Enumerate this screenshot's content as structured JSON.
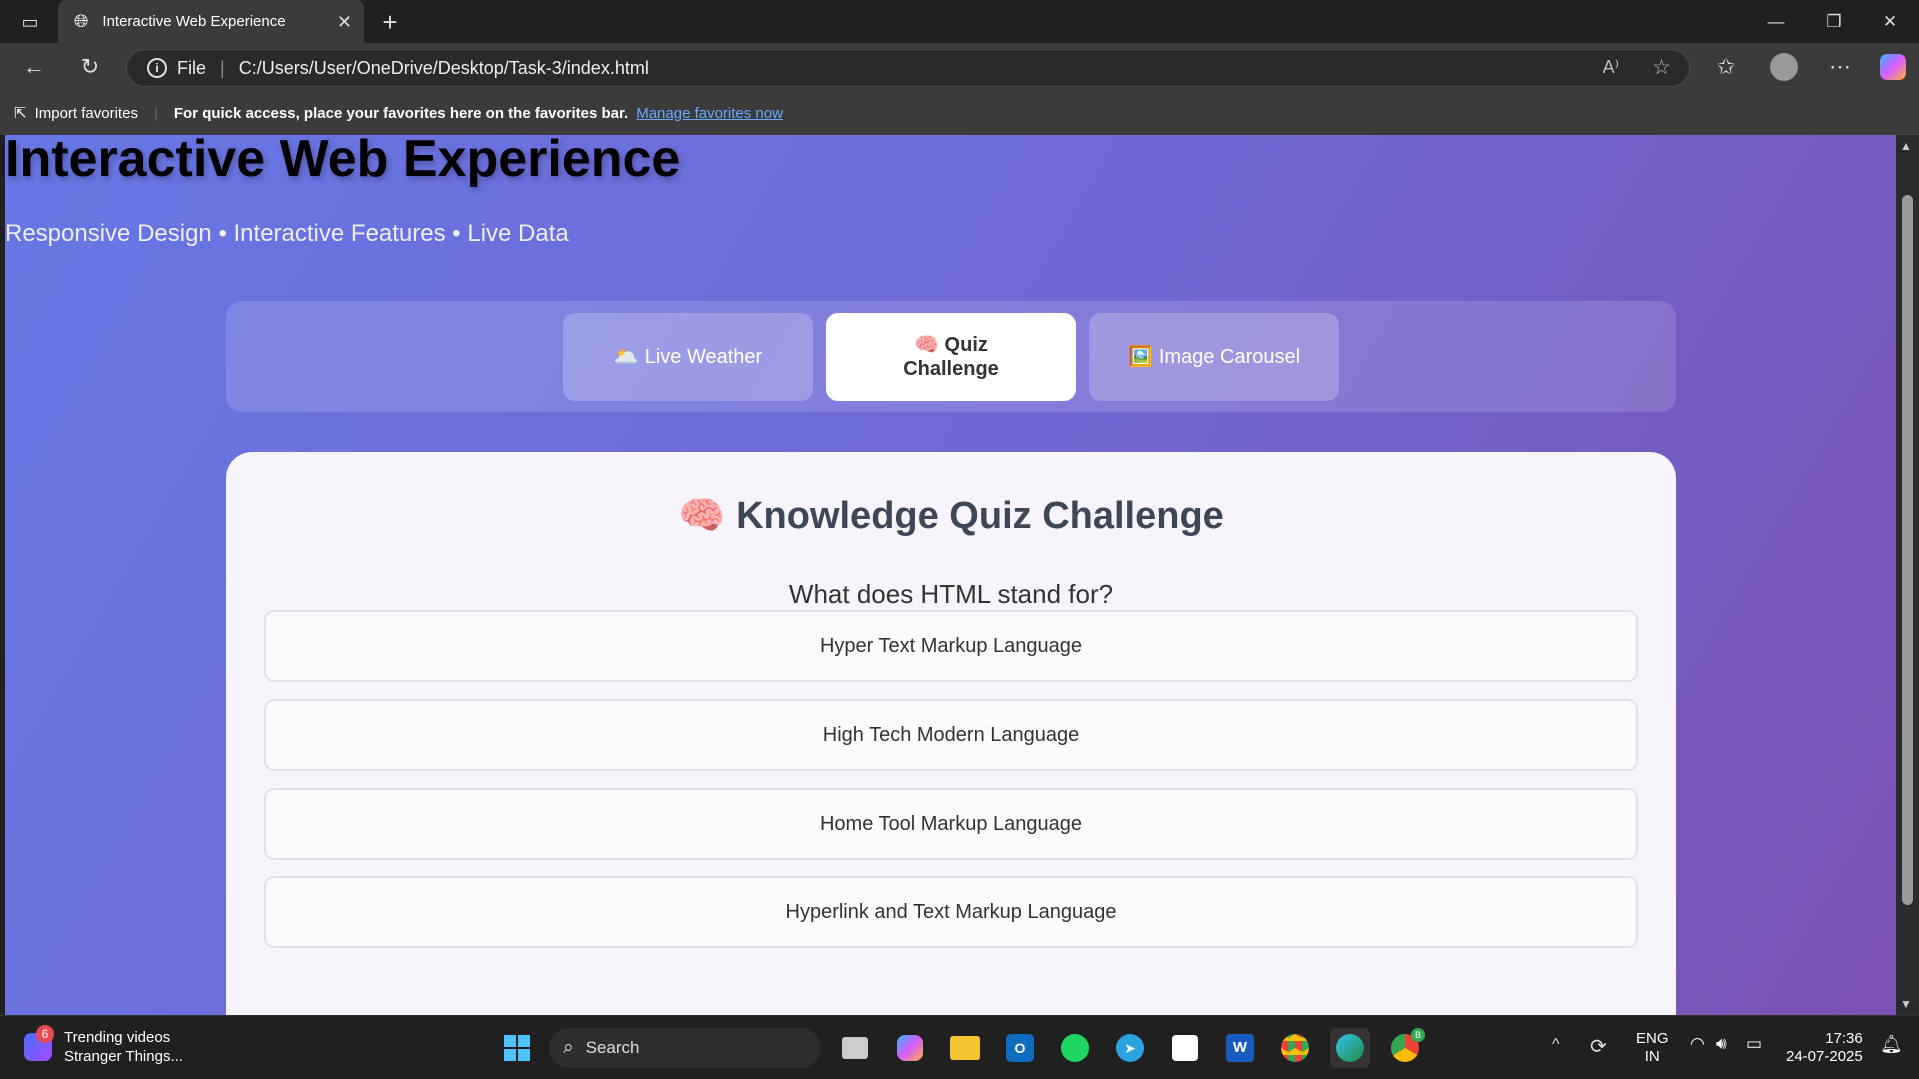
{
  "browser": {
    "tab_title": "Interactive Web Experience",
    "url_scheme": "File",
    "url_path": "C:/Users/User/OneDrive/Desktop/Task-3/index.html",
    "favorites": {
      "import_label": "Import favorites",
      "hint": "For quick access, place your favorites here on the favorites bar.",
      "manage_link": "Manage favorites now"
    }
  },
  "page": {
    "title": "Interactive Web Experience",
    "subtitle": "Responsive Design • Interactive Features • Live Data",
    "nav": [
      {
        "label": "Live Weather",
        "icon": "🌥️",
        "active": false
      },
      {
        "label_line1": "Quiz",
        "label_line2": "Challenge",
        "icon": "🧠",
        "active": true
      },
      {
        "label": "Image Carousel",
        "icon": "🖼️",
        "active": false
      }
    ],
    "quiz": {
      "icon": "🧠",
      "title": "Knowledge Quiz Challenge",
      "question": "What does HTML stand for?",
      "options": [
        "Hyper Text Markup Language",
        "High Tech Modern Language",
        "Home Tool Markup Language",
        "Hyperlink and Text Markup Language"
      ]
    }
  },
  "taskbar": {
    "widget_badge": "6",
    "widget_title": "Trending videos",
    "widget_sub": "Stranger Things...",
    "search_label": "Search",
    "lang_line1": "ENG",
    "lang_line2": "IN",
    "time": "17:36",
    "date": "24-07-2025",
    "chrome_badge": "B"
  }
}
